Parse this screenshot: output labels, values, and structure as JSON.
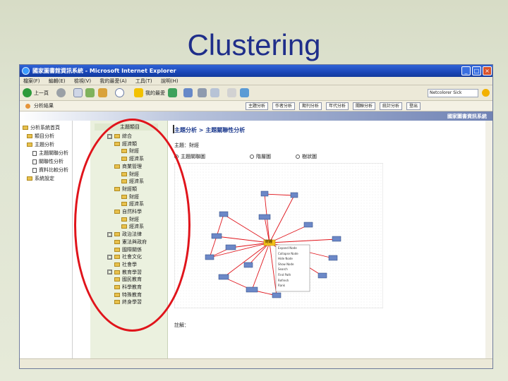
{
  "slide_title": "Clustering",
  "window": {
    "title": "國家圖書館資訊系統 - Microsoft Internet Explorer",
    "minimize": "_",
    "maximize": "□",
    "close": "×"
  },
  "menu": [
    "檔案(F)",
    "編輯(E)",
    "檢視(V)",
    "我的最愛(A)",
    "工具(T)",
    "說明(H)"
  ],
  "toolbar": {
    "back_label": "上一頁",
    "favorites_label": "我的最愛",
    "user_field": "Netcolorer Sick"
  },
  "address": {
    "text": "分析結果"
  },
  "nav_buttons": [
    "主題分析",
    "作者分析",
    "期刊分析",
    "年代分析",
    "關聯分析",
    "統計分析",
    "登出"
  ],
  "banner": {
    "text": "國家圖書資訊系統"
  },
  "left_tree": [
    "分析系統首頁",
    "類目分析",
    "主題分析",
    "主題關聯分析",
    "關聯性分析",
    "資料比較分析",
    "系統設定"
  ],
  "mid_panel": {
    "header": "主題類目",
    "items": [
      {
        "label": "綜合",
        "indent": 2,
        "type": "folder",
        "expander": "□"
      },
      {
        "label": "經濟類",
        "indent": 3,
        "type": "folder"
      },
      {
        "label": "財經",
        "indent": 4,
        "type": "folder"
      },
      {
        "label": "經濟系",
        "indent": 4,
        "type": "folder"
      },
      {
        "label": "商業管理",
        "indent": 3,
        "type": "folder"
      },
      {
        "label": "財經",
        "indent": 4,
        "type": "folder"
      },
      {
        "label": "經濟系",
        "indent": 4,
        "type": "folder"
      },
      {
        "label": "財經類",
        "indent": 3,
        "type": "folder"
      },
      {
        "label": "財經",
        "indent": 4,
        "type": "folder"
      },
      {
        "label": "經濟系",
        "indent": 4,
        "type": "folder"
      },
      {
        "label": "自然科學",
        "indent": 3,
        "type": "folder"
      },
      {
        "label": "財經",
        "indent": 4,
        "type": "folder"
      },
      {
        "label": "經濟系",
        "indent": 4,
        "type": "folder"
      },
      {
        "label": "政治法律",
        "indent": 2,
        "type": "folder",
        "expander": "□"
      },
      {
        "label": "憲法與政府",
        "indent": 3,
        "type": "folder"
      },
      {
        "label": "國際關係",
        "indent": 3,
        "type": "folder"
      },
      {
        "label": "社會文化",
        "indent": 2,
        "type": "folder",
        "expander": "□"
      },
      {
        "label": "社會學",
        "indent": 3,
        "type": "folder"
      },
      {
        "label": "教育學習",
        "indent": 2,
        "type": "folder",
        "expander": "□"
      },
      {
        "label": "國民教育",
        "indent": 3,
        "type": "folder"
      },
      {
        "label": "科學教育",
        "indent": 3,
        "type": "folder"
      },
      {
        "label": "特殊教育",
        "indent": 3,
        "type": "folder"
      },
      {
        "label": "終身學習",
        "indent": 3,
        "type": "folder"
      }
    ]
  },
  "content": {
    "title": "主題分析 > 主題關聯性分析",
    "hint": "主題：財經",
    "radios": [
      {
        "label": "主題關聯圖",
        "checked": true
      },
      {
        "label": "階層圖",
        "checked": false
      },
      {
        "label": "樹狀圖",
        "checked": false
      }
    ],
    "footer": "註解："
  },
  "graph": {
    "center_node": "財經",
    "menu_items": [
      "Expand Node",
      "Collapse Node",
      "Hide Node",
      "Show Node",
      "Search",
      "Find Path",
      "Refresh",
      "Rank"
    ]
  },
  "colors": {
    "accent": "#1f2e8a",
    "edge": "#e0141b",
    "highlight_oval": "#e0141b"
  }
}
